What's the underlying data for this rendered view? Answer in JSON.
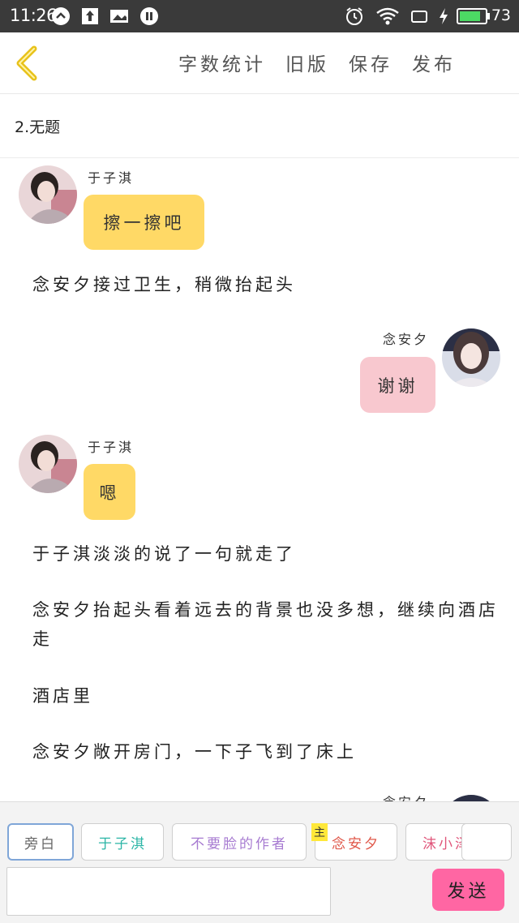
{
  "status_bar": {
    "time": "11:26",
    "battery_level": "73"
  },
  "header": {
    "actions": [
      "字数统计",
      "旧版",
      "保存",
      "发布"
    ]
  },
  "chapter": {
    "title": "2.无题"
  },
  "messages": [
    {
      "type": "bubble",
      "side": "left",
      "sender": "于子淇",
      "text": "擦一擦吧",
      "color": "#ffd966"
    },
    {
      "type": "narration",
      "text": "念安夕接过卫生，稍微抬起头"
    },
    {
      "type": "bubble",
      "side": "right",
      "sender": "念安夕",
      "text": "谢谢",
      "color": "#f8c8cf"
    },
    {
      "type": "bubble",
      "side": "left",
      "sender": "于子淇",
      "text": "嗯",
      "color": "#ffd966"
    },
    {
      "type": "narration",
      "text": "于子淇淡淡的说了一句就走了"
    },
    {
      "type": "narration",
      "text": "念安夕抬起头看着远去的背景也没多想，继续向酒店走"
    },
    {
      "type": "narration",
      "text": "酒店里"
    },
    {
      "type": "narration",
      "text": "念安夕敞开房门，一下子飞到了床上"
    },
    {
      "type": "bubble",
      "side": "right",
      "sender": "念安夕",
      "text": "",
      "color": "#f8c8cf"
    }
  ],
  "composer": {
    "roles": [
      {
        "label": "旁白",
        "color": "#666666"
      },
      {
        "label": "于子淇",
        "color": "#2bb5a6"
      },
      {
        "label": "不要脸的作者",
        "color": "#a77bd1"
      },
      {
        "label": "念安夕",
        "color": "#e0584a"
      },
      {
        "label": "沫小泽",
        "color": "#e0557a"
      }
    ],
    "main_tag": "主",
    "input_value": "",
    "send_label": "发送"
  },
  "colors": {
    "accent_yellow": "#ffd966",
    "accent_pink": "#f8c8cf",
    "send_button": "#ff66a3",
    "back_arrow": "#f2c81c"
  }
}
